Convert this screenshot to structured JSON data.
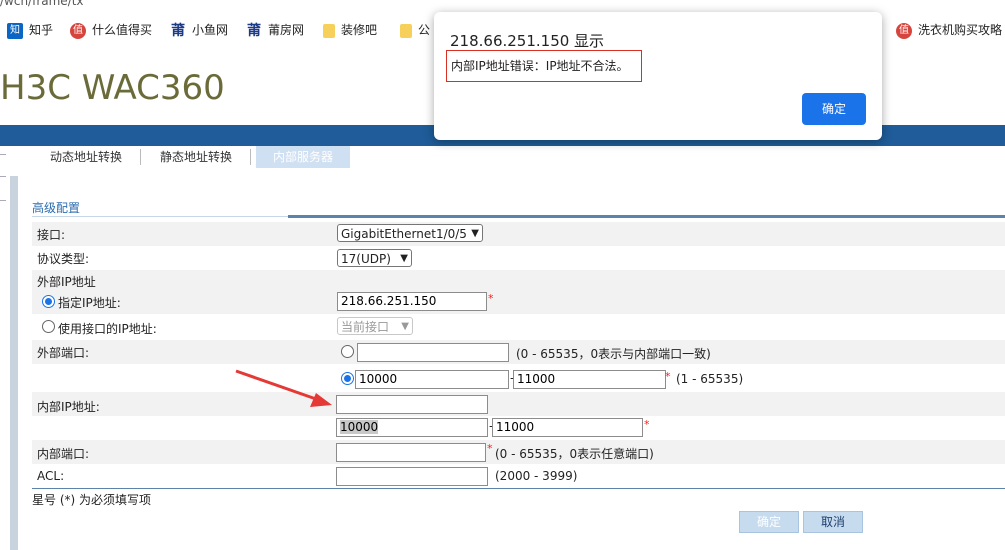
{
  "browser": {
    "url_fragment": "/wcn/frame/tx",
    "bookmarks": [
      {
        "label": "知乎",
        "icon": "zhihu-icon",
        "glyph": "知"
      },
      {
        "label": "什么值得买",
        "icon": "smzdm-icon",
        "glyph": "值"
      },
      {
        "label": "小鱼网",
        "icon": "xiaoyu-icon",
        "glyph": "莆"
      },
      {
        "label": "莆房网",
        "icon": "pufang-icon",
        "glyph": "莆"
      },
      {
        "label": "装修吧",
        "icon": "folder-icon",
        "glyph": ""
      },
      {
        "label": "公",
        "icon": "folder-icon",
        "glyph": ""
      },
      {
        "label": "洗衣机购买攻略",
        "icon": "smzdm-icon",
        "glyph": "值"
      }
    ]
  },
  "header": {
    "product": "H3C WAC360"
  },
  "tabs": [
    {
      "label": "动态地址转换"
    },
    {
      "label": "静态地址转换"
    },
    {
      "label": "内部服务器"
    }
  ],
  "section": {
    "title": "高级配置"
  },
  "form": {
    "interface_label": "接口:",
    "interface_value": "GigabitEthernet1/0/5",
    "protocol_label": "协议类型:",
    "protocol_value": "17(UDP)",
    "external_ip_group": "外部IP地址",
    "specify_ip_label": "指定IP地址:",
    "specify_ip_value": "218.66.251.150",
    "use_if_ip_label": "使用接口的IP地址:",
    "current_if_value": "当前接口",
    "external_port_label": "外部端口:",
    "external_port_hint": "(0 - 65535，0表示与内部端口一致)",
    "ext_range_start": "10000",
    "ext_range_end": "11000",
    "ext_range_hint": "(1 - 65535)",
    "internal_ip_label": "内部IP地址:",
    "int_range_start": "10000",
    "int_range_end": "11000",
    "internal_port_label": "内部端口:",
    "internal_port_hint": "(0 - 65535，0表示任意端口)",
    "acl_label": "ACL:",
    "acl_hint": "(2000 - 3999)",
    "required": "*",
    "dash": "-"
  },
  "footer": {
    "note": "星号 (*) 为必须填写项",
    "ok_label": "确定",
    "cancel_label": "取消"
  },
  "dialog": {
    "title": "218.66.251.150 显示",
    "message": "内部IP地址错误：IP地址不合法。",
    "ok_label": "确定"
  },
  "colors": {
    "accent_bar": "#1f5c99",
    "dialog_button": "#1a73e8",
    "error_border": "#d93025",
    "annotation_arrow": "#e53935"
  }
}
